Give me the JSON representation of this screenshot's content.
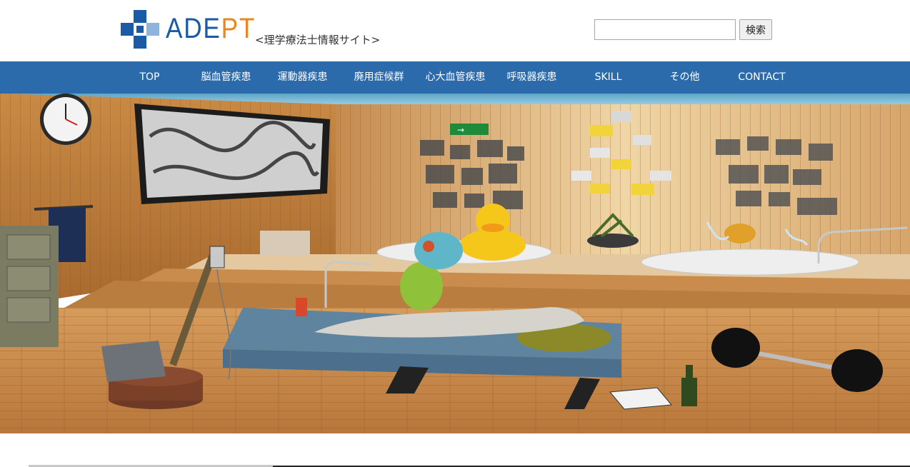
{
  "brand": {
    "logo_part1": "ADE",
    "logo_part2": "PT",
    "tagline": "<理学療法士情報サイト>",
    "colors": {
      "blue": "#1b5aa5",
      "orange": "#e8881e"
    }
  },
  "search": {
    "value": "",
    "placeholder": "",
    "button_label": "検索"
  },
  "nav": {
    "color": "#2c6bab",
    "items": [
      {
        "label": "TOP"
      },
      {
        "label": "脳血管疾患"
      },
      {
        "label": "運動器疾患"
      },
      {
        "label": "廃用症候群"
      },
      {
        "label": "心大血管疾患"
      },
      {
        "label": "呼吸器疾患"
      },
      {
        "label": "SKILL"
      },
      {
        "label": "その他"
      },
      {
        "label": "CONTACT"
      }
    ]
  },
  "hero": {
    "exit_sign": "→"
  }
}
